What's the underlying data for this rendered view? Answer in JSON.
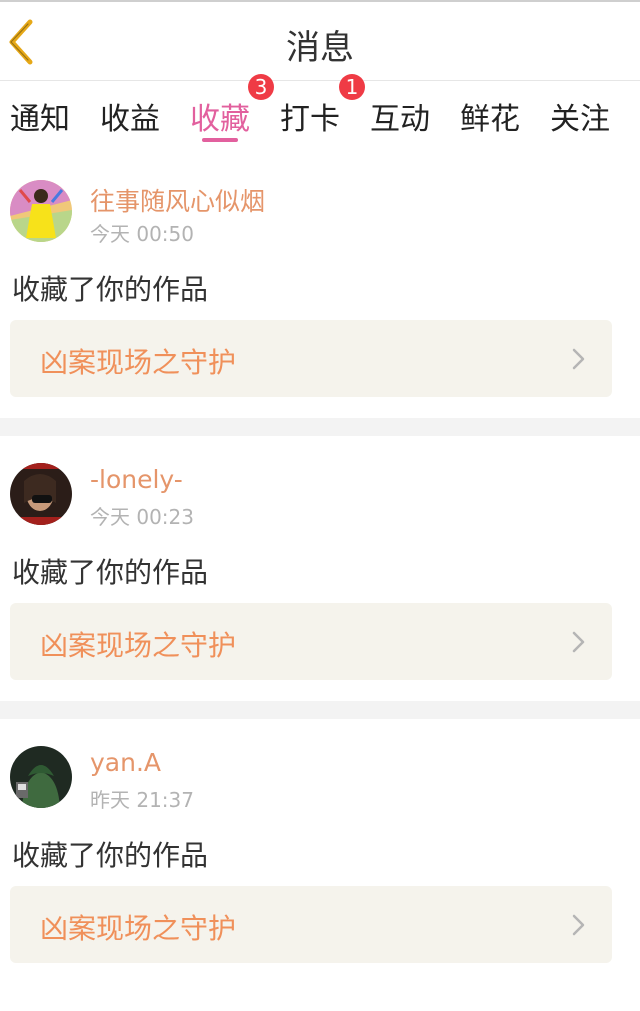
{
  "header": {
    "title": "消息",
    "back_icon": "chevron-left-icon"
  },
  "tabs": [
    {
      "label": "通知"
    },
    {
      "label": "收益"
    },
    {
      "label": "收藏",
      "badge": "3",
      "active": true
    },
    {
      "label": "打卡",
      "badge": "1"
    },
    {
      "label": "互动"
    },
    {
      "label": "鲜花"
    },
    {
      "label": "关注"
    }
  ],
  "colors": {
    "accent": "#e2609e",
    "badge": "#ef3b45",
    "username": "#e5956a",
    "work_title": "#f0905a",
    "card_bg": "#f5f3ec"
  },
  "messages": [
    {
      "username": "往事随风心似烟",
      "time": "今天 00:50",
      "action": "收藏了你的作品",
      "work_title": "凶案现场之守护",
      "icon": "chevron-right-icon"
    },
    {
      "username": "-lonely-",
      "time": "今天 00:23",
      "action": "收藏了你的作品",
      "work_title": "凶案现场之守护",
      "icon": "chevron-right-icon"
    },
    {
      "username": "yan.A",
      "time": "昨天 21:37",
      "action": "收藏了你的作品",
      "work_title": "凶案现场之守护",
      "icon": "chevron-right-icon"
    }
  ]
}
